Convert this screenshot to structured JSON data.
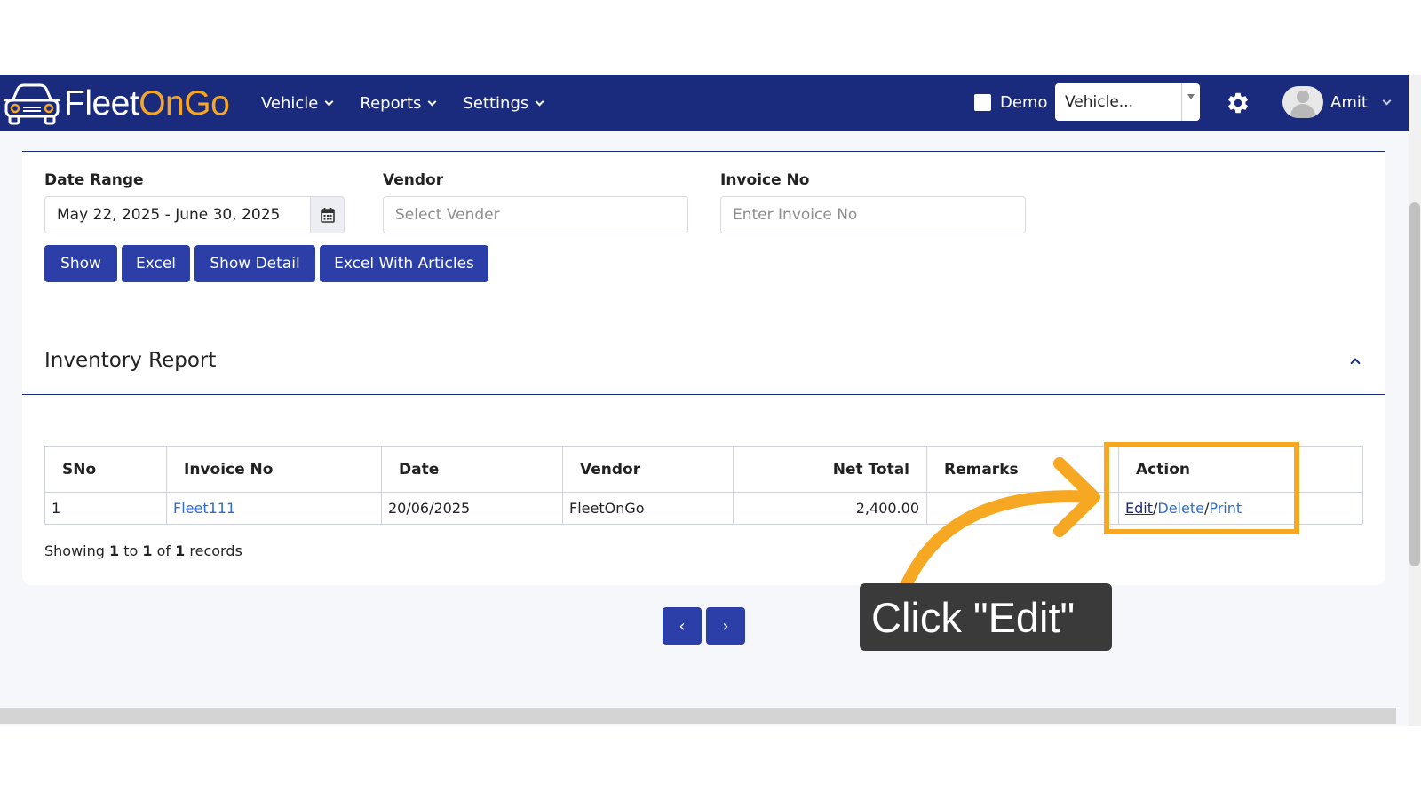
{
  "app": {
    "logo_parts": {
      "fleet": "Fleet",
      "on": "On",
      "go": "Go"
    }
  },
  "nav": {
    "menu": [
      {
        "label": "Vehicle"
      },
      {
        "label": "Reports"
      },
      {
        "label": "Settings"
      }
    ],
    "demo_label": "Demo",
    "vehicle_select_value": "Vehicle...",
    "user_name": "Amit"
  },
  "filters": {
    "date_range_label": "Date Range",
    "date_range_value": "May 22, 2025 - June 30, 2025",
    "vendor_label": "Vendor",
    "vendor_placeholder": "Select Vender",
    "invoice_label": "Invoice No",
    "invoice_placeholder": "Enter Invoice No",
    "buttons": {
      "show": "Show",
      "excel": "Excel",
      "show_detail": "Show Detail",
      "excel_articles": "Excel With Articles"
    }
  },
  "report": {
    "title": "Inventory Report",
    "columns": [
      "SNo",
      "Invoice No",
      "Date",
      "Vendor",
      "Net Total",
      "Remarks",
      "Action"
    ],
    "rows": [
      {
        "sno": "1",
        "invoice_no": "Fleet111",
        "date": "20/06/2025",
        "vendor": "FleetOnGo",
        "net_total": "2,400.00",
        "remarks": ""
      }
    ],
    "actions": {
      "edit": "Edit",
      "delete": "Delete",
      "print": "Print",
      "separator": "/"
    },
    "showing": {
      "prefix": "Showing",
      "from": "1",
      "to_word": "to",
      "to": "1",
      "of_word": "of",
      "total": "1",
      "suffix": "records"
    }
  },
  "pager": {
    "prev": "‹",
    "next": "›"
  },
  "annotation": {
    "callout_text": "Click \"Edit\"",
    "highlight_color": "#f7a823"
  },
  "colors": {
    "navbar": "#1a2a7c",
    "button": "#2c3fa8",
    "link": "#2d6bd6",
    "logo_accent": "#f5a623"
  }
}
